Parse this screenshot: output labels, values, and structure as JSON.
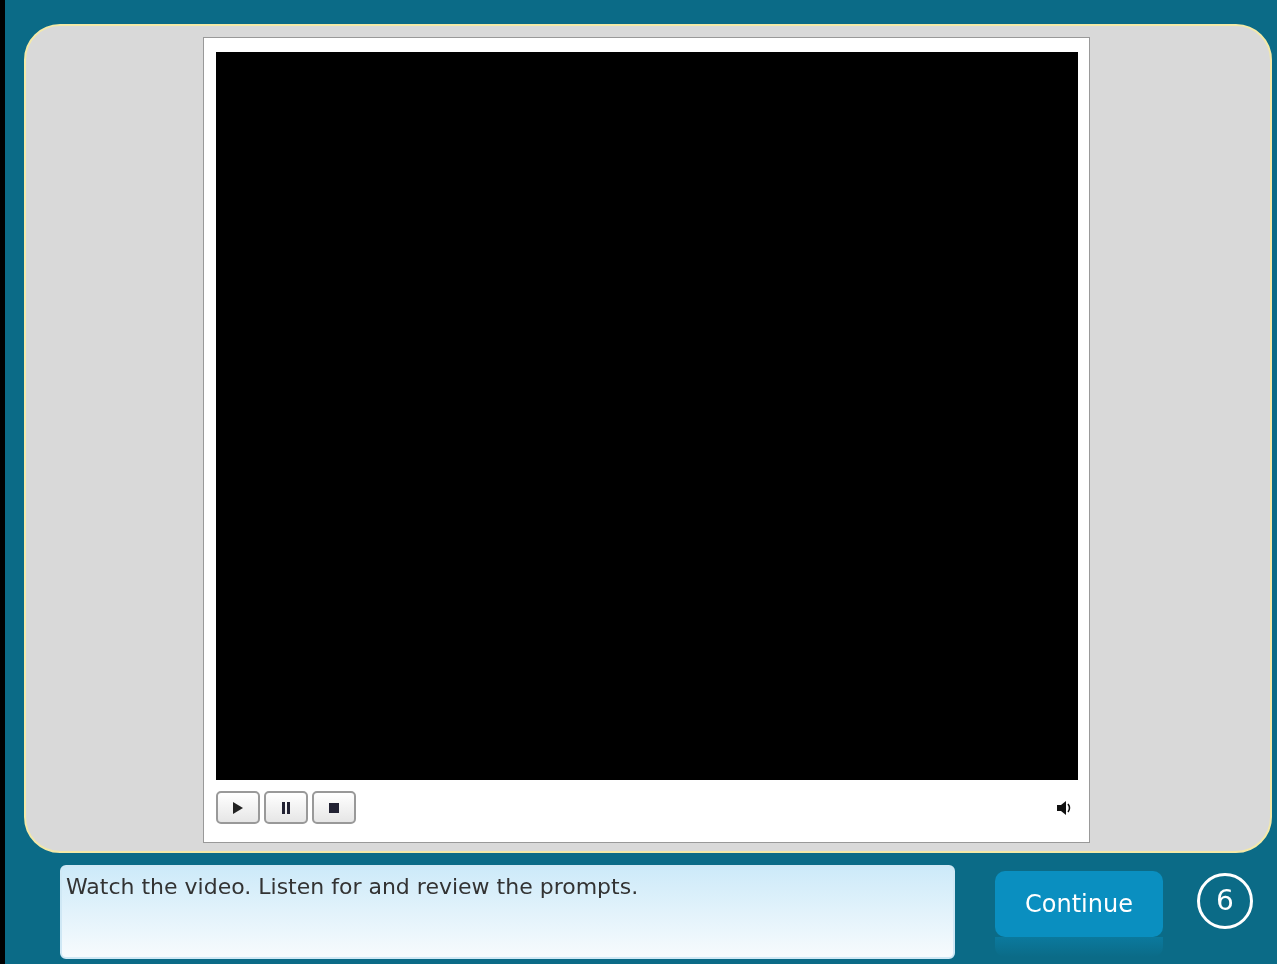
{
  "player": {
    "controls": [
      {
        "kind": "play"
      },
      {
        "kind": "pause"
      },
      {
        "kind": "stop"
      }
    ]
  },
  "instruction": "Watch the video. Listen for and review the prompts.",
  "continue_button": "Continue",
  "step_number": "6"
}
